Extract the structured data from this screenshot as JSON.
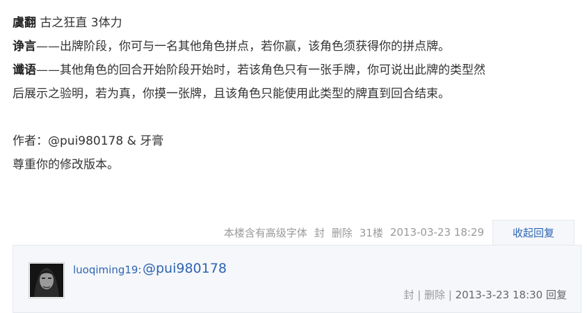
{
  "post": {
    "line1": {
      "name": "虞翻",
      "text": "古之狂直 3体力"
    },
    "line2": {
      "name": "诤言",
      "text": "——出牌阶段，你可与一名其他角色拼点，若你赢，该角色须获得你的拼点牌。"
    },
    "line3": {
      "name": "谶语",
      "text": "——其他角色的回合开始阶段开始时，若该角色只有一张手牌，你可说出此牌的类型然"
    },
    "line4": "后展示之验明，若为真，你摸一张牌，且该角色只能使用此类型的牌直到回合结束。",
    "author": "作者：@pui980178 & 牙膏",
    "respect": "尊重你的修改版本。"
  },
  "footer": {
    "font_note": "本楼含有高级字体",
    "block": "封",
    "delete": "删除",
    "floor": "31楼",
    "time": "2013-03-23 18:29",
    "toggle": "收起回复"
  },
  "reply": {
    "user": "luoqiming19:",
    "text": "@pui980178",
    "block": "封",
    "sep1": "|",
    "delete": "删除",
    "sep2": "|",
    "time": "2013-3-23 18:30",
    "reply": "回复"
  }
}
